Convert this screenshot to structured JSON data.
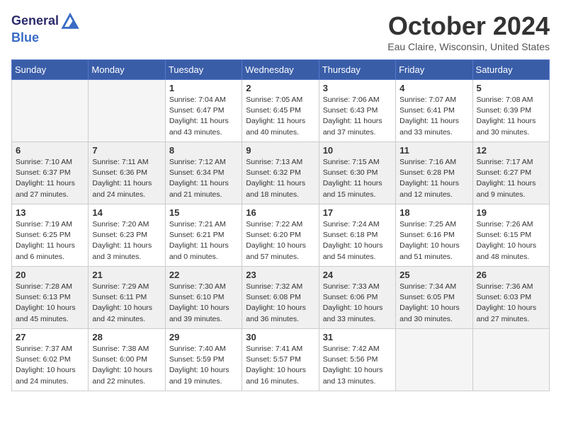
{
  "header": {
    "logo_line1": "General",
    "logo_line2": "Blue",
    "month": "October 2024",
    "location": "Eau Claire, Wisconsin, United States"
  },
  "days_of_week": [
    "Sunday",
    "Monday",
    "Tuesday",
    "Wednesday",
    "Thursday",
    "Friday",
    "Saturday"
  ],
  "weeks": [
    [
      {
        "num": "",
        "info": ""
      },
      {
        "num": "",
        "info": ""
      },
      {
        "num": "1",
        "info": "Sunrise: 7:04 AM\nSunset: 6:47 PM\nDaylight: 11 hours and 43 minutes."
      },
      {
        "num": "2",
        "info": "Sunrise: 7:05 AM\nSunset: 6:45 PM\nDaylight: 11 hours and 40 minutes."
      },
      {
        "num": "3",
        "info": "Sunrise: 7:06 AM\nSunset: 6:43 PM\nDaylight: 11 hours and 37 minutes."
      },
      {
        "num": "4",
        "info": "Sunrise: 7:07 AM\nSunset: 6:41 PM\nDaylight: 11 hours and 33 minutes."
      },
      {
        "num": "5",
        "info": "Sunrise: 7:08 AM\nSunset: 6:39 PM\nDaylight: 11 hours and 30 minutes."
      }
    ],
    [
      {
        "num": "6",
        "info": "Sunrise: 7:10 AM\nSunset: 6:37 PM\nDaylight: 11 hours and 27 minutes."
      },
      {
        "num": "7",
        "info": "Sunrise: 7:11 AM\nSunset: 6:36 PM\nDaylight: 11 hours and 24 minutes."
      },
      {
        "num": "8",
        "info": "Sunrise: 7:12 AM\nSunset: 6:34 PM\nDaylight: 11 hours and 21 minutes."
      },
      {
        "num": "9",
        "info": "Sunrise: 7:13 AM\nSunset: 6:32 PM\nDaylight: 11 hours and 18 minutes."
      },
      {
        "num": "10",
        "info": "Sunrise: 7:15 AM\nSunset: 6:30 PM\nDaylight: 11 hours and 15 minutes."
      },
      {
        "num": "11",
        "info": "Sunrise: 7:16 AM\nSunset: 6:28 PM\nDaylight: 11 hours and 12 minutes."
      },
      {
        "num": "12",
        "info": "Sunrise: 7:17 AM\nSunset: 6:27 PM\nDaylight: 11 hours and 9 minutes."
      }
    ],
    [
      {
        "num": "13",
        "info": "Sunrise: 7:19 AM\nSunset: 6:25 PM\nDaylight: 11 hours and 6 minutes."
      },
      {
        "num": "14",
        "info": "Sunrise: 7:20 AM\nSunset: 6:23 PM\nDaylight: 11 hours and 3 minutes."
      },
      {
        "num": "15",
        "info": "Sunrise: 7:21 AM\nSunset: 6:21 PM\nDaylight: 11 hours and 0 minutes."
      },
      {
        "num": "16",
        "info": "Sunrise: 7:22 AM\nSunset: 6:20 PM\nDaylight: 10 hours and 57 minutes."
      },
      {
        "num": "17",
        "info": "Sunrise: 7:24 AM\nSunset: 6:18 PM\nDaylight: 10 hours and 54 minutes."
      },
      {
        "num": "18",
        "info": "Sunrise: 7:25 AM\nSunset: 6:16 PM\nDaylight: 10 hours and 51 minutes."
      },
      {
        "num": "19",
        "info": "Sunrise: 7:26 AM\nSunset: 6:15 PM\nDaylight: 10 hours and 48 minutes."
      }
    ],
    [
      {
        "num": "20",
        "info": "Sunrise: 7:28 AM\nSunset: 6:13 PM\nDaylight: 10 hours and 45 minutes."
      },
      {
        "num": "21",
        "info": "Sunrise: 7:29 AM\nSunset: 6:11 PM\nDaylight: 10 hours and 42 minutes."
      },
      {
        "num": "22",
        "info": "Sunrise: 7:30 AM\nSunset: 6:10 PM\nDaylight: 10 hours and 39 minutes."
      },
      {
        "num": "23",
        "info": "Sunrise: 7:32 AM\nSunset: 6:08 PM\nDaylight: 10 hours and 36 minutes."
      },
      {
        "num": "24",
        "info": "Sunrise: 7:33 AM\nSunset: 6:06 PM\nDaylight: 10 hours and 33 minutes."
      },
      {
        "num": "25",
        "info": "Sunrise: 7:34 AM\nSunset: 6:05 PM\nDaylight: 10 hours and 30 minutes."
      },
      {
        "num": "26",
        "info": "Sunrise: 7:36 AM\nSunset: 6:03 PM\nDaylight: 10 hours and 27 minutes."
      }
    ],
    [
      {
        "num": "27",
        "info": "Sunrise: 7:37 AM\nSunset: 6:02 PM\nDaylight: 10 hours and 24 minutes."
      },
      {
        "num": "28",
        "info": "Sunrise: 7:38 AM\nSunset: 6:00 PM\nDaylight: 10 hours and 22 minutes."
      },
      {
        "num": "29",
        "info": "Sunrise: 7:40 AM\nSunset: 5:59 PM\nDaylight: 10 hours and 19 minutes."
      },
      {
        "num": "30",
        "info": "Sunrise: 7:41 AM\nSunset: 5:57 PM\nDaylight: 10 hours and 16 minutes."
      },
      {
        "num": "31",
        "info": "Sunrise: 7:42 AM\nSunset: 5:56 PM\nDaylight: 10 hours and 13 minutes."
      },
      {
        "num": "",
        "info": ""
      },
      {
        "num": "",
        "info": ""
      }
    ]
  ]
}
